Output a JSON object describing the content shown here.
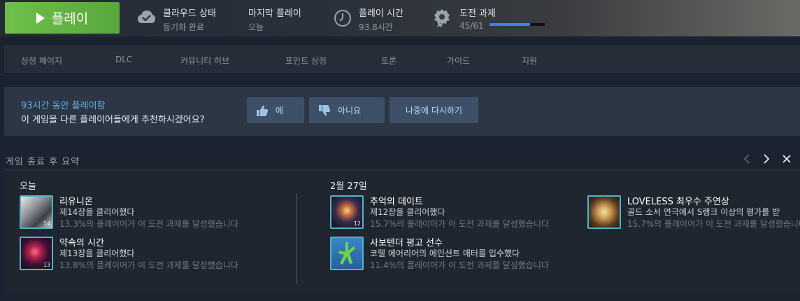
{
  "topbar": {
    "play_label": "플레이",
    "cloud": {
      "title": "클라우드 상태",
      "sub": "동기화 완료"
    },
    "last_played": {
      "title": "마지막 플레이",
      "sub": "오늘"
    },
    "playtime": {
      "title": "플레이 시간",
      "sub": "93.8시간"
    },
    "achievements": {
      "title": "도전 과제",
      "sub": "45/61",
      "progress": 0.74,
      "bar_color": "#3f7ff0"
    }
  },
  "nav": {
    "items": [
      "상점 페이지",
      "DLC",
      "커뮤니티 허브",
      "포인트 상점",
      "토론",
      "가이드",
      "지원"
    ]
  },
  "recommend": {
    "line1": "93시간 동안 플레이함",
    "line2": "이 게임을 다른 플레이어들에게 추천하시겠어요?",
    "yes": "예",
    "no": "아니요",
    "later": "나중에 다시하기"
  },
  "summary": {
    "title": "게임 종료 후 요약",
    "today_label": "오늘",
    "date_label": "2월 27일",
    "today": [
      {
        "name": "리유니온",
        "desc": "제14장을 클리어했다",
        "pct": "13.3%의 플레이어가 이 도전 과제를 달성했습니다",
        "badge": "14"
      },
      {
        "name": "약속의 시간",
        "desc": "제13장을 클리어했다",
        "pct": "13.8%의 플레이어가 이 도전 과제를 달성했습니다",
        "badge": "13"
      }
    ],
    "feb27": [
      {
        "name": "추억의 데이트",
        "desc": "제12장을 클리어했다",
        "pct": "15.7%의 플레이어가 이 도전 과제를 달성했습니다",
        "badge": "12"
      },
      {
        "name": "사보텐더 평고 선수",
        "desc": "코렐 에어리어의 에인션트 매터를 입수했다",
        "pct": "11.4%의 플레이어가 이 도전 과제를 달성했습니다",
        "badge": ""
      }
    ],
    "feb27_col2": [
      {
        "name": "LOVELESS 최우수 주연상",
        "desc": "골드 소서 연극에서 S랭크 이상의 평가를 받",
        "pct": "15.7%의 플레이어가 이 도전 과제를 달성했습니다",
        "badge": ""
      }
    ]
  },
  "colors": {
    "play_green": "#5fb043",
    "accent_blue": "#66aee5",
    "thumb_border": "#4bb7c6"
  }
}
